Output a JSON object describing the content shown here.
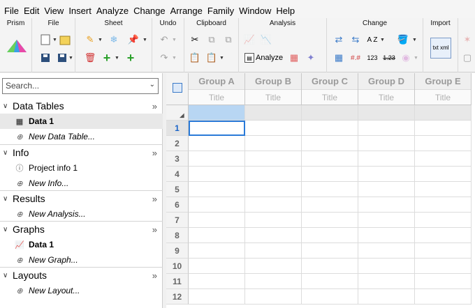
{
  "menu": [
    "File",
    "Edit",
    "View",
    "Insert",
    "Analyze",
    "Change",
    "Arrange",
    "Family",
    "Window",
    "Help"
  ],
  "ribbon": {
    "groups": [
      "Prism",
      "File",
      "Sheet",
      "Undo",
      "Clipboard",
      "Analysis",
      "Change",
      "Import"
    ],
    "analyze_label": "Analyze",
    "sort_label": "A Z",
    "num_label": "123",
    "num_strike_label": "1.23",
    "xml_label": "txt xml"
  },
  "sidebar": {
    "search_placeholder": "Search...",
    "sections": [
      {
        "label": "Data Tables",
        "items": [
          {
            "label": "Data 1"
          },
          {
            "label": "New Data Table..."
          }
        ]
      },
      {
        "label": "Info",
        "items": [
          {
            "label": "Project info 1"
          },
          {
            "label": "New Info..."
          }
        ]
      },
      {
        "label": "Results",
        "items": [
          {
            "label": "New Analysis..."
          }
        ]
      },
      {
        "label": "Graphs",
        "items": [
          {
            "label": "Data 1"
          },
          {
            "label": "New Graph..."
          }
        ]
      },
      {
        "label": "Layouts",
        "items": [
          {
            "label": "New Layout..."
          }
        ]
      }
    ]
  },
  "table": {
    "columns": [
      "Group A",
      "Group B",
      "Group C",
      "Group D",
      "Group E"
    ],
    "title_placeholder": "Title",
    "rows": [
      "1",
      "2",
      "3",
      "4",
      "5",
      "6",
      "7",
      "8",
      "9",
      "10",
      "11",
      "12"
    ]
  },
  "colors": {
    "accent": "#2a7ad8",
    "selected_cell": "#b8d6f3"
  }
}
